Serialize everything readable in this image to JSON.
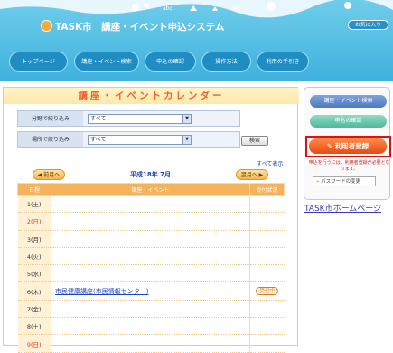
{
  "header": {
    "title": "TASK市　講座・イベント申込システム",
    "kids_button": "お気に入り",
    "colors": {
      "sky": "#4fbde6",
      "nav": "#1f8cc2"
    }
  },
  "nav": {
    "items": [
      "トップページ",
      "講座・イベント検索",
      "申込の確認",
      "操作方法",
      "利用の手引き"
    ]
  },
  "calendar": {
    "title": "講座・イベントカレンダー",
    "filter_field_label": "分野で絞り込み",
    "filter_field_value": "すべて",
    "filter_place_label": "場所で絞り込み",
    "filter_place_value": "すべて",
    "search_button": "検索",
    "show_all": "すべて表示",
    "prev_month": "前月へ",
    "next_month": "翌月へ",
    "month_label": "平成18年 7月",
    "columns": [
      "日程",
      "講座・イベント",
      "受付状況"
    ],
    "rows": [
      {
        "day": "1(土)",
        "type": "sat",
        "event": "",
        "status": ""
      },
      {
        "day": "2(日)",
        "type": "sun",
        "event": "",
        "status": ""
      },
      {
        "day": "3(月)",
        "type": "wd",
        "event": "",
        "status": ""
      },
      {
        "day": "4(火)",
        "type": "wd",
        "event": "",
        "status": ""
      },
      {
        "day": "5(水)",
        "type": "wd",
        "event": "",
        "status": ""
      },
      {
        "day": "6(木)",
        "type": "wd",
        "event": "市民健康講座(市民情報センター)",
        "status": "受付中"
      },
      {
        "day": "7(金)",
        "type": "wd",
        "event": "",
        "status": ""
      },
      {
        "day": "8(土)",
        "type": "sat",
        "event": "",
        "status": ""
      },
      {
        "day": "9(日)",
        "type": "sun",
        "event": "",
        "status": ""
      }
    ]
  },
  "sidebar": {
    "search_button": "講座・イベント検索",
    "confirm_button": "申込の確認",
    "register_button": "利用者登録",
    "register_note": "申込を行うには、利用者登録が必要となります。",
    "password_button": "パスワードの変更",
    "home_link": "TASK市ホームページ"
  }
}
